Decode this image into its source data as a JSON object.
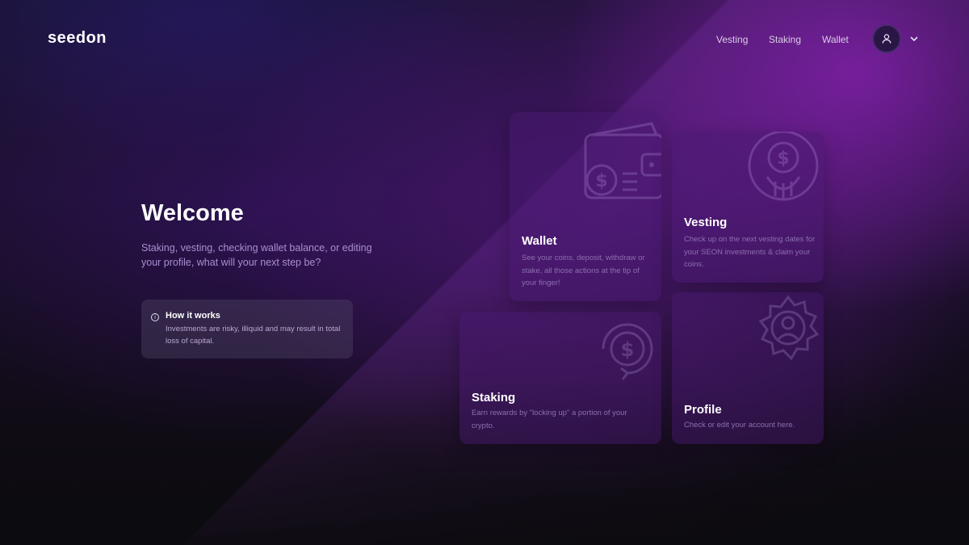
{
  "header": {
    "logo_text": "seedon",
    "logo_accent_color": "#22c55e",
    "nav": [
      {
        "label": "Vesting"
      },
      {
        "label": "Staking"
      },
      {
        "label": "Wallet"
      }
    ],
    "avatar_icon": "user-icon",
    "dropdown_icon": "chevron-down-icon"
  },
  "hero": {
    "title": "Welcome",
    "subtitle": "Staking, vesting, checking wallet balance, or editing your profile, what will your next step be?"
  },
  "info": {
    "icon": "info-icon",
    "title": "How it works",
    "text": "Investments are risky, illiquid and may result in total loss of capital."
  },
  "cards": {
    "wallet": {
      "title": "Wallet",
      "description": "See your coins, deposit, withdraw or stake, all those actions at the tip of your finger!",
      "icon": "wallet-icon"
    },
    "vesting": {
      "title": "Vesting",
      "description": "Check up on the next vesting dates for your SEON investments & claim your coins.",
      "icon": "vesting-icon"
    },
    "staking": {
      "title": "Staking",
      "description": "Earn rewards by \"locking up\" a portion of your crypto.",
      "icon": "staking-icon"
    },
    "profile": {
      "title": "Profile",
      "description": "Check or edit your account here.",
      "icon": "profile-icon"
    }
  },
  "colors": {
    "background": "#0b0a0f",
    "accent_purple": "#8b2fc9",
    "card": "#46196e",
    "subtitle": "#a98fd0"
  }
}
